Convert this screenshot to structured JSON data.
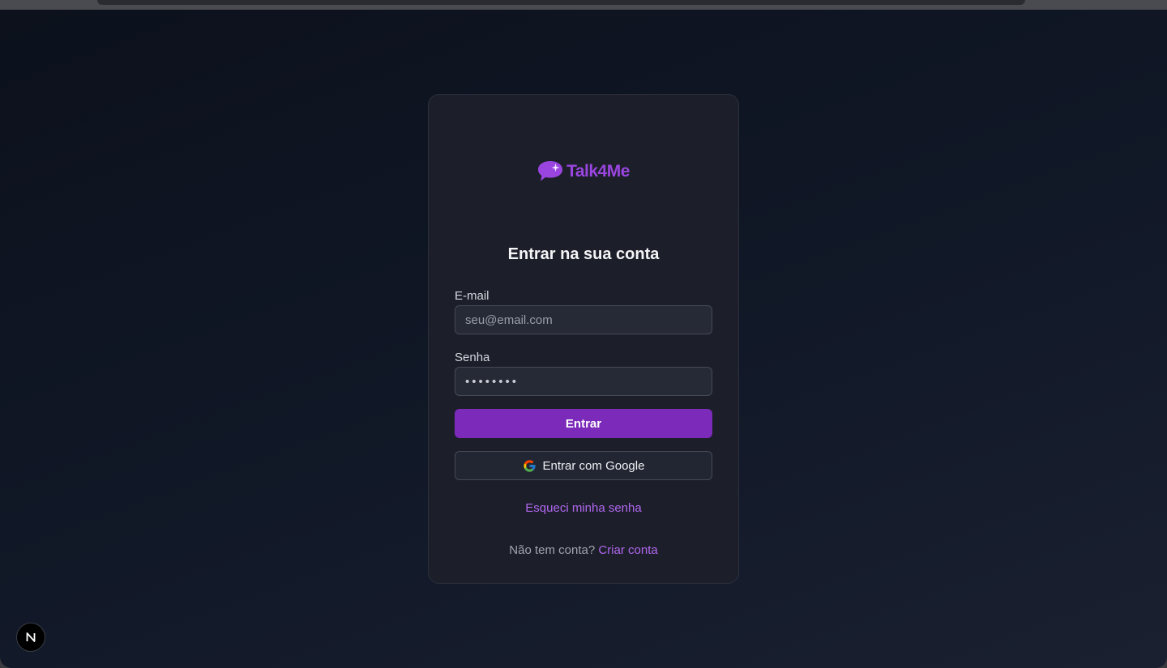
{
  "app": {
    "brand_name": "Talk4Me",
    "brand_color": "#9b45e0",
    "logo_icon": "chat-bubble-sparkle-icon"
  },
  "login": {
    "title": "Entrar na sua conta",
    "email_label": "E-mail",
    "email_placeholder": "seu@email.com",
    "email_value": "",
    "password_label": "Senha",
    "password_value": "••••••••",
    "submit_label": "Entrar",
    "submit_color": "#7b2ab9",
    "google_label": "Entrar com Google",
    "google_icon": "google-icon",
    "forgot_label": "Esqueci minha senha",
    "signup_prompt": "Não tem conta?",
    "signup_link": "Criar conta",
    "link_color": "#b267f0"
  },
  "overlay": {
    "dev_badge_icon": "nextjs-icon",
    "dev_badge_letter": "N"
  }
}
